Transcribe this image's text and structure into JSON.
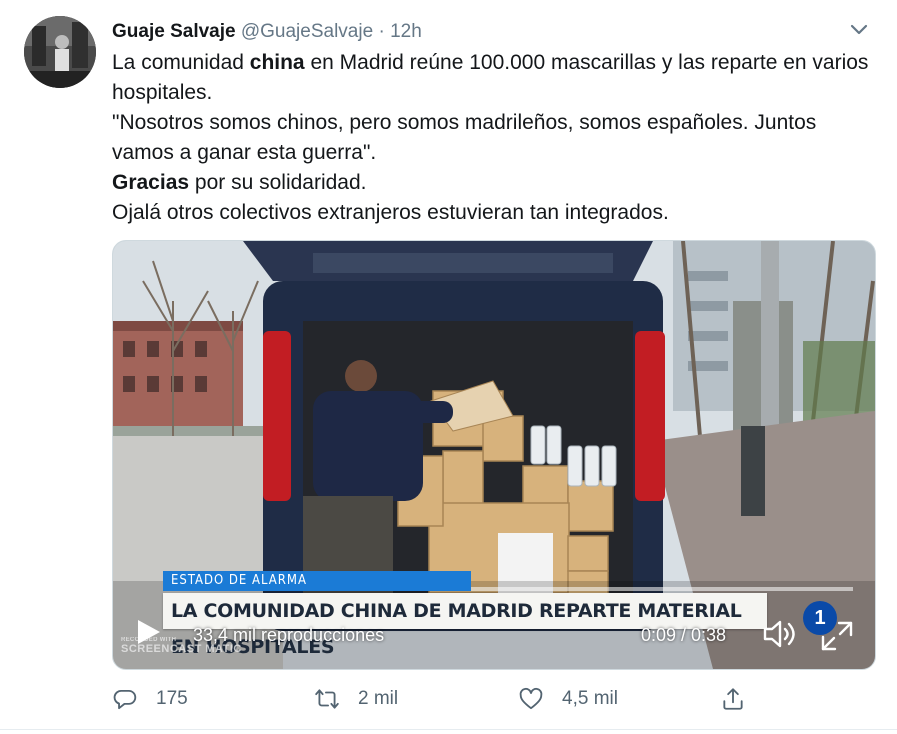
{
  "tweet": {
    "author_name": "Guaje Salvaje",
    "handle": "@GuajeSalvaje",
    "separator": "·",
    "time": "12h",
    "text": {
      "line1_pre": "La comunidad ",
      "line1_bold": "china",
      "line1_post": " en Madrid reúne 100.000 mascarillas y las reparte en varios hospitales.",
      "line2": "\"Nosotros somos chinos, pero somos madrileños, somos españoles. Juntos vamos a ganar esta guerra\".",
      "line3_bold": "Gracias",
      "line3_post": " por su solidaridad.",
      "line4": "Ojalá otros colectivos extranjeros estuvieran tan integrados."
    }
  },
  "video": {
    "banner_small": "ESTADO DE ALARMA",
    "banner_big": "LA COMUNIDAD CHINA DE MADRID REPARTE MATERIAL EN HOSPITALES",
    "views": "33,4 mil reproducciones",
    "timecode": "0:09 / 0:38",
    "progress": 0.237,
    "watermark_small": "RECORDED WITH",
    "watermark": "SCREENCAST MATIC",
    "channel_logo": "1"
  },
  "actions": {
    "replies": "175",
    "retweets": "2 mil",
    "likes": "4,5 mil"
  },
  "colors": {
    "accent": "#1d9bf0",
    "text": "#14171a",
    "secondary": "#657786",
    "banner_blue": "#1b7bd6"
  },
  "icons": [
    "avatar",
    "chevron-down-icon",
    "play-icon",
    "volume-icon",
    "fullscreen-icon",
    "reply-icon",
    "retweet-icon",
    "like-icon",
    "share-icon"
  ]
}
